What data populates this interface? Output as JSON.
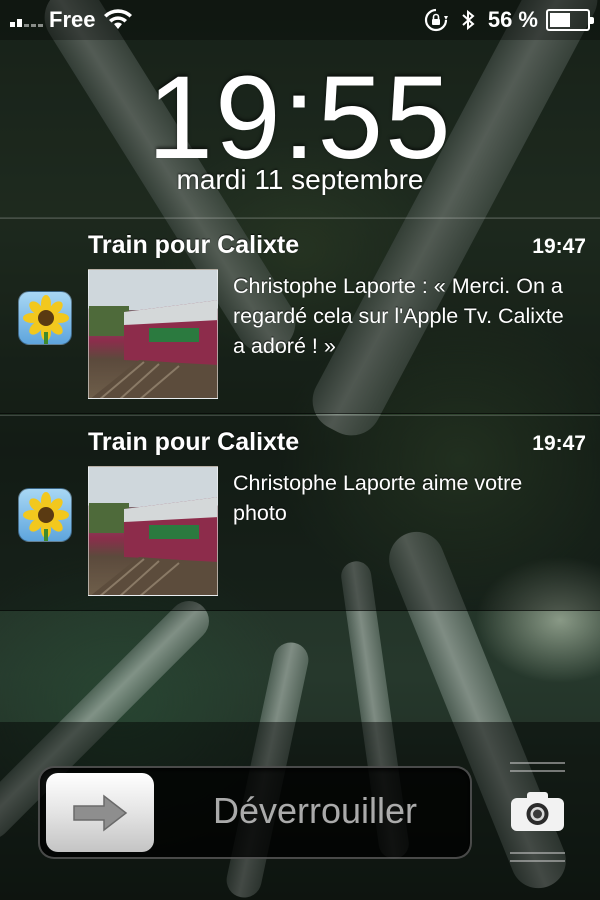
{
  "status_bar": {
    "carrier": "Free",
    "battery_percent": "56 %",
    "battery_level": 0.56,
    "icons": [
      "signal-icon",
      "wifi-icon",
      "rotation-lock-icon",
      "bluetooth-icon",
      "battery-icon"
    ]
  },
  "lock_screen": {
    "time": "19:55",
    "date": "mardi 11 septembre"
  },
  "notifications": [
    {
      "title": "Train pour Calixte",
      "time": "19:47",
      "message": "Christophe Laporte : « Merci. On a regardé cela sur l'Apple Tv. Calixte a adoré ! »",
      "app_icon": "photos-sunflower-icon"
    },
    {
      "title": "Train pour Calixte",
      "time": "19:47",
      "message": "Christophe Laporte aime votre photo",
      "app_icon": "photos-sunflower-icon"
    }
  ],
  "unlock": {
    "label": "Déverrouiller",
    "knob_icon": "arrow-right-icon"
  },
  "camera": {
    "icon": "camera-icon"
  }
}
